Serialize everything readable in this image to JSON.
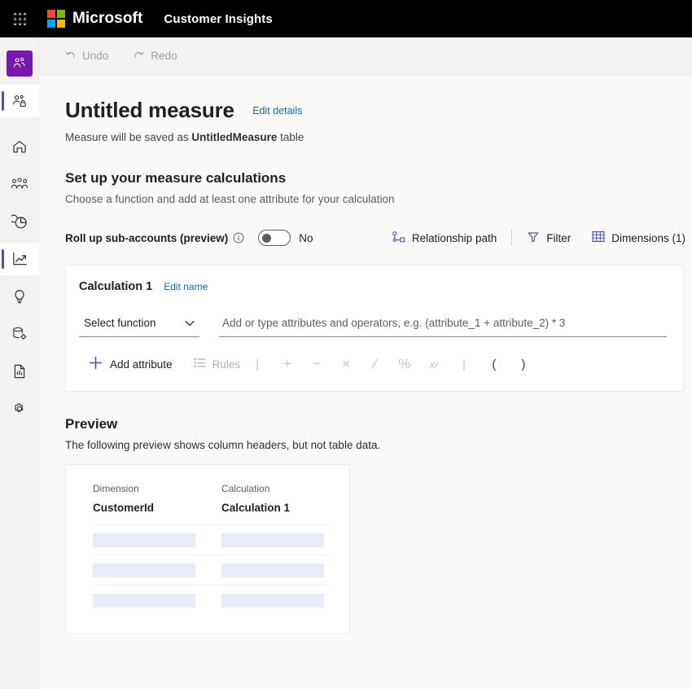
{
  "suite": {
    "waffle_icon": "app-launcher-icon",
    "brand": "Microsoft",
    "app_name": "Customer Insights",
    "logo_colors": [
      "#f25022",
      "#7fba00",
      "#00a4ef",
      "#ffb900"
    ]
  },
  "rail": {
    "hamburger_icon": "hamburger-menu-icon",
    "items": [
      {
        "name": "audience-insights",
        "icon": "people-audience-icon",
        "selected": true,
        "style": "purple"
      },
      {
        "name": "customer-profiles",
        "icon": "people-lock-icon",
        "selected": true,
        "style": "white"
      },
      {
        "name": "home",
        "icon": "home-icon",
        "selected": false,
        "style": ""
      },
      {
        "name": "customers",
        "icon": "people-group-icon",
        "selected": false,
        "style": ""
      },
      {
        "name": "segments",
        "icon": "pie-chart-icon",
        "selected": false,
        "style": ""
      },
      {
        "name": "measures",
        "icon": "trending-chart-icon",
        "selected": true,
        "style": "white-bar"
      },
      {
        "name": "insights",
        "icon": "lightbulb-icon",
        "selected": false,
        "style": ""
      },
      {
        "name": "data",
        "icon": "database-gear-icon",
        "selected": false,
        "style": ""
      },
      {
        "name": "reports",
        "icon": "document-chart-icon",
        "selected": false,
        "style": ""
      },
      {
        "name": "settings",
        "icon": "gear-icon",
        "selected": false,
        "style": ""
      }
    ]
  },
  "commandbar": {
    "undo": {
      "label": "Undo",
      "icon": "undo-arrow-icon",
      "disabled": true
    },
    "redo": {
      "label": "Redo",
      "icon": "redo-arrow-icon",
      "disabled": true
    }
  },
  "header": {
    "title": "Untitled measure",
    "edit_details_link": "Edit details",
    "save_note_prefix": "Measure will be saved as ",
    "save_note_table": "UntitledMeasure",
    "save_note_suffix": " table"
  },
  "setup": {
    "heading": "Set up your measure calculations",
    "subheading": "Choose a function and add at least one attribute for your calculation"
  },
  "options": {
    "rollup_label": "Roll up sub-accounts (preview)",
    "info_icon": "info-circle-icon",
    "toggle_state": "No",
    "toggle_on": false,
    "relationship_path": {
      "label": "Relationship path",
      "icon": "relationship-path-icon"
    },
    "filter": {
      "label": "Filter",
      "icon": "filter-funnel-icon"
    },
    "dimensions": {
      "label": "Dimensions (1)",
      "icon": "table-grid-icon"
    },
    "accent_color": "#4f52b2"
  },
  "calculation": {
    "title": "Calculation 1",
    "edit_name_link": "Edit name",
    "function_select": {
      "value": "Select function",
      "chevron_icon": "chevron-down-icon"
    },
    "expression": {
      "value": "",
      "placeholder": "Add or type attributes and operators, e.g. (attribute_1 + attribute_2) * 3"
    },
    "toolbar": {
      "add_attribute": {
        "label": "Add attribute",
        "icon": "plus-icon"
      },
      "rules": {
        "label": "Rules",
        "icon": "list-rules-icon",
        "disabled": true
      },
      "operators": [
        {
          "name": "plus-operator",
          "glyph": "+",
          "enabled": false
        },
        {
          "name": "minus-operator",
          "glyph": "−",
          "enabled": false
        },
        {
          "name": "multiply-operator",
          "glyph": "×",
          "enabled": false
        },
        {
          "name": "divide-operator",
          "glyph": "∕",
          "enabled": false
        },
        {
          "name": "percent-operator",
          "glyph": "%",
          "enabled": false
        },
        {
          "name": "power-operator",
          "glyph": "x",
          "sup": "y",
          "enabled": false
        }
      ],
      "parens": [
        {
          "name": "open-paren-operator",
          "glyph": "(",
          "enabled": true
        },
        {
          "name": "close-paren-operator",
          "glyph": ")",
          "enabled": true
        }
      ]
    }
  },
  "preview": {
    "heading": "Preview",
    "subheading": "The following preview shows column headers, but not table data.",
    "columns": [
      {
        "header": "Dimension",
        "value": "CustomerId"
      },
      {
        "header": "Calculation",
        "value": "Calculation 1"
      }
    ],
    "placeholder_rows": 3,
    "skeleton_color": "#e8ecf9"
  }
}
